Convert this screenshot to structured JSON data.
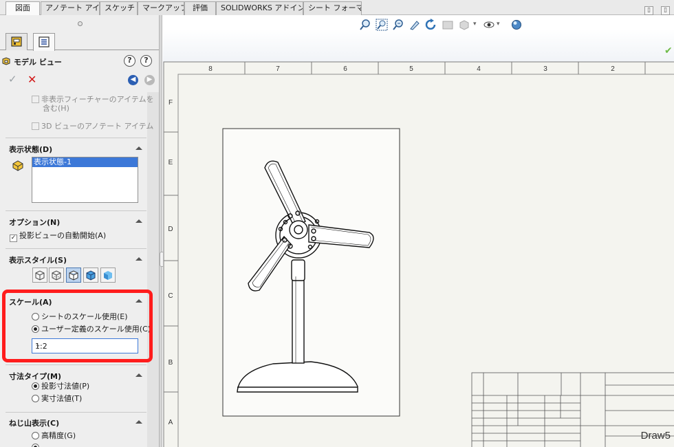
{
  "cmd_tabs": [
    "図面",
    "アノテート アイテム",
    "スケッチ",
    "マークアップ",
    "評価",
    "SOLIDWORKS アドイン",
    "シート フォーマット"
  ],
  "panel": {
    "title": "モデル ビュー",
    "hidden_features_label": "非表示フィーチャーのアイテムを",
    "hidden_features_label2": "含む(H)",
    "view_3d_annot_label": "3D ビューのアノテート アイテム",
    "display_state": {
      "heading": "表示状態(D)",
      "items": [
        "表示状態-1"
      ]
    },
    "options": {
      "heading": "オプション(N)",
      "auto_start_label": "投影ビューの自動開始(A)"
    },
    "display_style": {
      "heading": "表示スタイル(S)"
    },
    "scale": {
      "heading": "スケール(A)",
      "sheet_scale_label": "シートのスケール使用(E)",
      "custom_scale_label": "ユーザー定義のスケール使用(C)",
      "custom_value": "1:2"
    },
    "dim_type": {
      "heading": "寸法タイプ(M)",
      "projected_label": "投影寸法値(P)",
      "true_label": "実寸法値(T)"
    },
    "thread": {
      "heading": "ねじ山表示(C)",
      "high_quality_label": "高精度(G)"
    }
  },
  "drawing": {
    "col_labels": [
      "8",
      "7",
      "6",
      "5",
      "4",
      "3",
      "2"
    ],
    "row_labels": [
      "F",
      "E",
      "D",
      "C",
      "B",
      "A"
    ],
    "title_block_text": "Draw5"
  },
  "colors": {
    "highlight": "#ff1c1c",
    "selection": "#3c78d8",
    "cancel": "#d21818"
  }
}
